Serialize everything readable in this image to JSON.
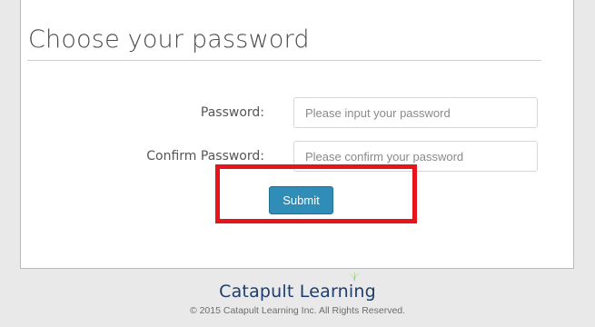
{
  "form": {
    "title": "Choose your password",
    "password": {
      "label": "Password:",
      "placeholder": "Please input your password",
      "value": ""
    },
    "confirm": {
      "label": "Confirm Password:",
      "placeholder": "Please confirm your password",
      "value": ""
    },
    "submit_label": "Submit"
  },
  "footer": {
    "brand": "Catapult Learning",
    "copyright": "© 2015 Catapult Learning Inc. All Rights Reserved."
  },
  "colors": {
    "button": "#2f8db8",
    "highlight": "#e8141c",
    "brand": "#1d3d6e",
    "leaf_green": "#6ab23e",
    "leaf_blue": "#3aa0d8"
  },
  "icons": {
    "logo_leaf": "sprout-leaf-icon"
  }
}
